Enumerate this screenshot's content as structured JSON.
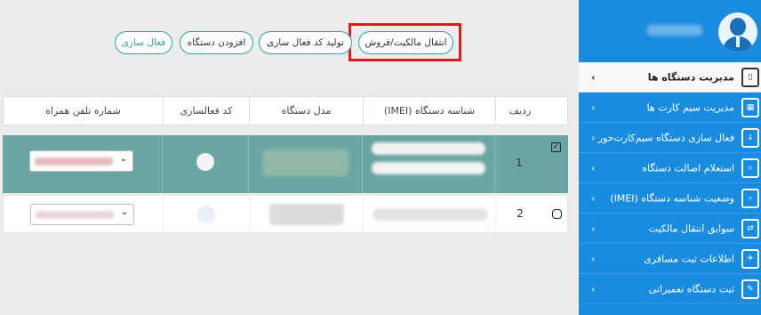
{
  "sidebar": {
    "menu": [
      {
        "label": "مدیریت دستگاه ها",
        "icon": "device-manage-icon",
        "active": true
      },
      {
        "label": "مدیریت سیم کارت ها",
        "icon": "sim-card-icon"
      },
      {
        "label": "فعال سازی دستگاه سیم‌کارت‌خور",
        "icon": "device-activate-icon"
      },
      {
        "label": "استعلام اصالت دستگاه",
        "icon": "search-device-icon"
      },
      {
        "label": "وضعیت شناسه دستگاه (IMEI)",
        "icon": "imei-status-icon"
      },
      {
        "label": "سوابق انتقال مالکیت",
        "icon": "transfer-history-icon"
      },
      {
        "label": "اطلاعات ثبت مسافری",
        "icon": "traveler-icon"
      },
      {
        "label": "ثبت دستگاه تعمیراتی",
        "icon": "repair-icon"
      }
    ]
  },
  "toolbar": {
    "transfer": "انتقال مالکیت/فروش",
    "generate_code": "تولید کد فعال سازی",
    "add_device": "افزودن دستگاه",
    "activate": "فعال سازی"
  },
  "table": {
    "headers": {
      "row": "ردیف",
      "imei": "شناسه دستگاه (IMEI)",
      "model": "مدل دستگاه",
      "activation_code": "کد فعالسازی",
      "phone": "شماره تلفن همراه"
    },
    "rows": [
      {
        "index": "1",
        "checked": true
      },
      {
        "index": "2",
        "checked": false
      }
    ]
  },
  "colors": {
    "sidebar": "#1a8ce0",
    "selected_row": "#6aa5a4",
    "button_border": "#2aa6a0",
    "highlight": "#e01b1b"
  }
}
